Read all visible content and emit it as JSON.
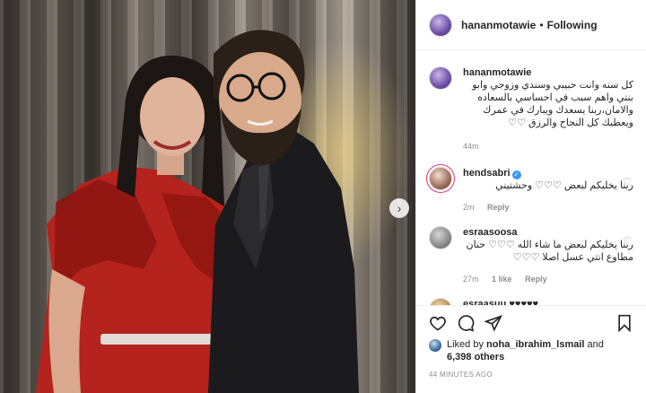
{
  "post": {
    "username": "hananmotawie",
    "follow_status": "Following",
    "separator": "•"
  },
  "caption": {
    "username": "hananmotawie",
    "text": "كل سنه وانت حبيبي وسندي وزوجي وابو بنتي واهم سبب في احساسي بالسعاده والامان،ربنا يسعدك ويبارك في عمرك ويعطيك كل النجاح والرزق ♡♡",
    "time": "44m"
  },
  "comments": [
    {
      "username": "hendsabri",
      "verified": true,
      "text": "ربنا يخليكم لبعض ♡♡♡ وحشتيني",
      "time": "2m",
      "likes": "",
      "reply": "Reply"
    },
    {
      "username": "esraasoosa",
      "verified": false,
      "text": "ربنا يخليكم لبعض ما شاء الله ♡♡♡ حنان مطاوع انتي عسل اصلا ♡♡♡",
      "time": "27m",
      "likes": "1 like",
      "reply": "Reply"
    },
    {
      "username": "esraasuu",
      "verified": false,
      "text": "♥♥♥♥♥",
      "time": "",
      "likes": "",
      "reply": ""
    }
  ],
  "likes": {
    "liked_by_prefix": "Liked by",
    "liked_by_user": "noha_ibrahim_lsmail",
    "and": "and",
    "others_count": "6,398 others"
  },
  "timestamp": "44 MINUTES AGO",
  "icons": {
    "like": "heart-icon",
    "comment": "comment-icon",
    "share": "share-icon",
    "save": "bookmark-icon",
    "next": "chevron-right-icon",
    "comment_like": "heart-icon"
  },
  "colors": {
    "link_blue": "#3897f0",
    "meta_gray": "#8e8e8e",
    "text": "#262626",
    "story_ring": "#e1306c"
  }
}
